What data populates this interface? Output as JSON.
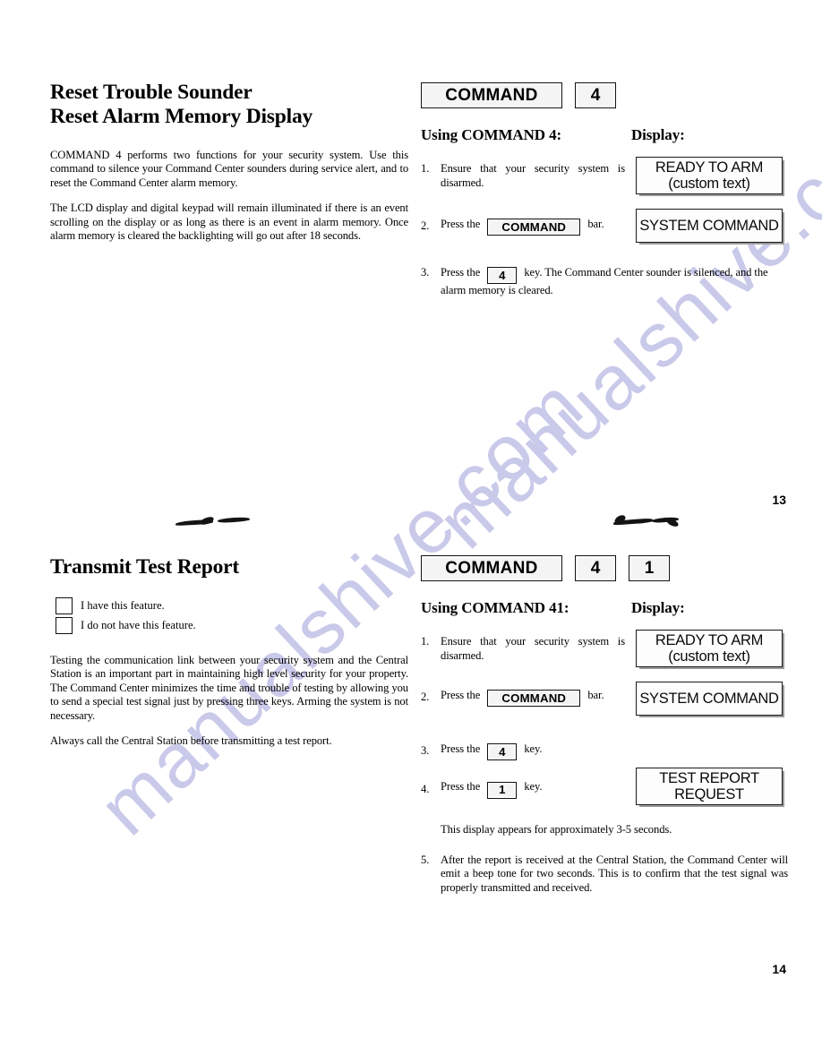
{
  "watermark": {
    "text_a": "manualshive.com",
    "text_b": "manualshive.com",
    "color": "#c9c9ea"
  },
  "page_13": {
    "number": "13",
    "heading_line1": "Reset Trouble Sounder",
    "heading_line2": "Reset Alarm Memory Display",
    "paragraphs": [
      "COMMAND 4 performs two functions for your security system. Use this command to silence your Command Center sounders during service alert, and to reset the Command Center alarm memory.",
      "The LCD display and digital keypad will remain illuminated if there is an event scrolling on the display or as long as there is an event in alarm memory. Once alarm memory is cleared the backlighting will go out after 18 seconds."
    ],
    "keys": [
      {
        "label": "COMMAND",
        "type": "command"
      },
      {
        "label": "4",
        "type": "number"
      }
    ],
    "using_label": "Using COMMAND 4:",
    "display_label": "Display:",
    "steps": [
      {
        "num": "1.",
        "text_before": "Ensure that your security system is disarmed.",
        "key": null,
        "text_after": ""
      },
      {
        "num": "2.",
        "text_before": "Press the",
        "key": "COMMAND",
        "key_type": "command",
        "text_after": "bar."
      },
      {
        "num": "3.",
        "text_before": "Press the",
        "key": "4",
        "key_type": "number",
        "text_after": "key. The Command Center sounder is silenced, and the alarm memory is cleared."
      }
    ],
    "displays": [
      {
        "line1": "READY TO ARM",
        "line2": "(custom text)"
      },
      {
        "line1": "SYSTEM COMMAND",
        "line2": ""
      }
    ]
  },
  "page_14": {
    "number": "14",
    "heading_line1": "Transmit Test Report",
    "checkboxes": [
      {
        "label": "I have this feature.",
        "checked": false
      },
      {
        "label": "I do not have this feature.",
        "checked": false
      }
    ],
    "paragraphs": [
      "Testing the communication link between your security system and the Central Station is an important part in maintaining high level security for your property.  The Command Center minimizes the time and trouble of testing by allowing you to send a special test signal just by pressing three keys.  Arming the system is not necessary.",
      "Always call the Central Station before transmitting a test report."
    ],
    "keys": [
      {
        "label": "COMMAND",
        "type": "command"
      },
      {
        "label": "4",
        "type": "number"
      },
      {
        "label": "1",
        "type": "number"
      }
    ],
    "using_label": "Using COMMAND 41:",
    "display_label": "Display:",
    "steps": [
      {
        "num": "1.",
        "text_before": "Ensure that your security system is disarmed.",
        "key": null,
        "text_after": ""
      },
      {
        "num": "2.",
        "text_before": "Press the",
        "key": "COMMAND",
        "key_type": "command",
        "text_after": "bar."
      },
      {
        "num": "3.",
        "text_before": "Press the",
        "key": "4",
        "key_type": "number",
        "text_after": "key."
      },
      {
        "num": "4.",
        "text_before": "Press the",
        "key": "1",
        "key_type": "number",
        "text_after": "key."
      },
      {
        "num": "5.",
        "text_before": "After the report is received at the Central Station, the Command Center will emit a beep tone for two seconds.  This is to confirm that the test signal was properly transmitted and received.",
        "key": null,
        "text_after": ""
      }
    ],
    "note": "This display appears for approximately 3-5 seconds.",
    "displays": [
      {
        "line1": "READY TO ARM",
        "line2": "(custom text)"
      },
      {
        "line1": "SYSTEM COMMAND",
        "line2": ""
      },
      {
        "line1": "TEST REPORT",
        "line2": "REQUEST"
      }
    ]
  }
}
